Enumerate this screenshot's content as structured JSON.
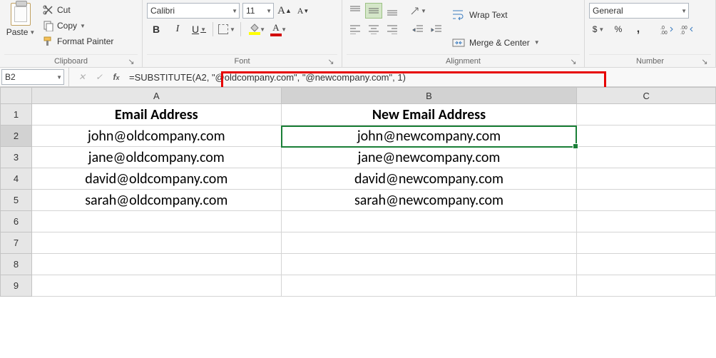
{
  "ribbon": {
    "clipboard": {
      "paste": "Paste",
      "cut": "Cut",
      "copy": "Copy",
      "fmtpainter": "Format Painter",
      "label": "Clipboard"
    },
    "font": {
      "name": "Calibri",
      "size": "11",
      "label": "Font"
    },
    "alignment": {
      "wrap": "Wrap Text",
      "merge": "Merge & Center",
      "label": "Alignment"
    },
    "number": {
      "format": "General",
      "label": "Number"
    }
  },
  "namebox": "B2",
  "formula": "=SUBSTITUTE(A2, \"@oldcompany.com\", \"@newcompany.com\", 1)",
  "cols": {
    "A": "A",
    "B": "B",
    "C": "C"
  },
  "rows": {
    "1": {
      "A": "Email Address",
      "B": "New Email Address"
    },
    "2": {
      "A": "john@oldcompany.com",
      "B": "john@newcompany.com"
    },
    "3": {
      "A": "jane@oldcompany.com",
      "B": "jane@newcompany.com"
    },
    "4": {
      "A": "david@oldcompany.com",
      "B": "david@newcompany.com"
    },
    "5": {
      "A": "sarah@oldcompany.com",
      "B": "sarah@newcompany.com"
    }
  }
}
